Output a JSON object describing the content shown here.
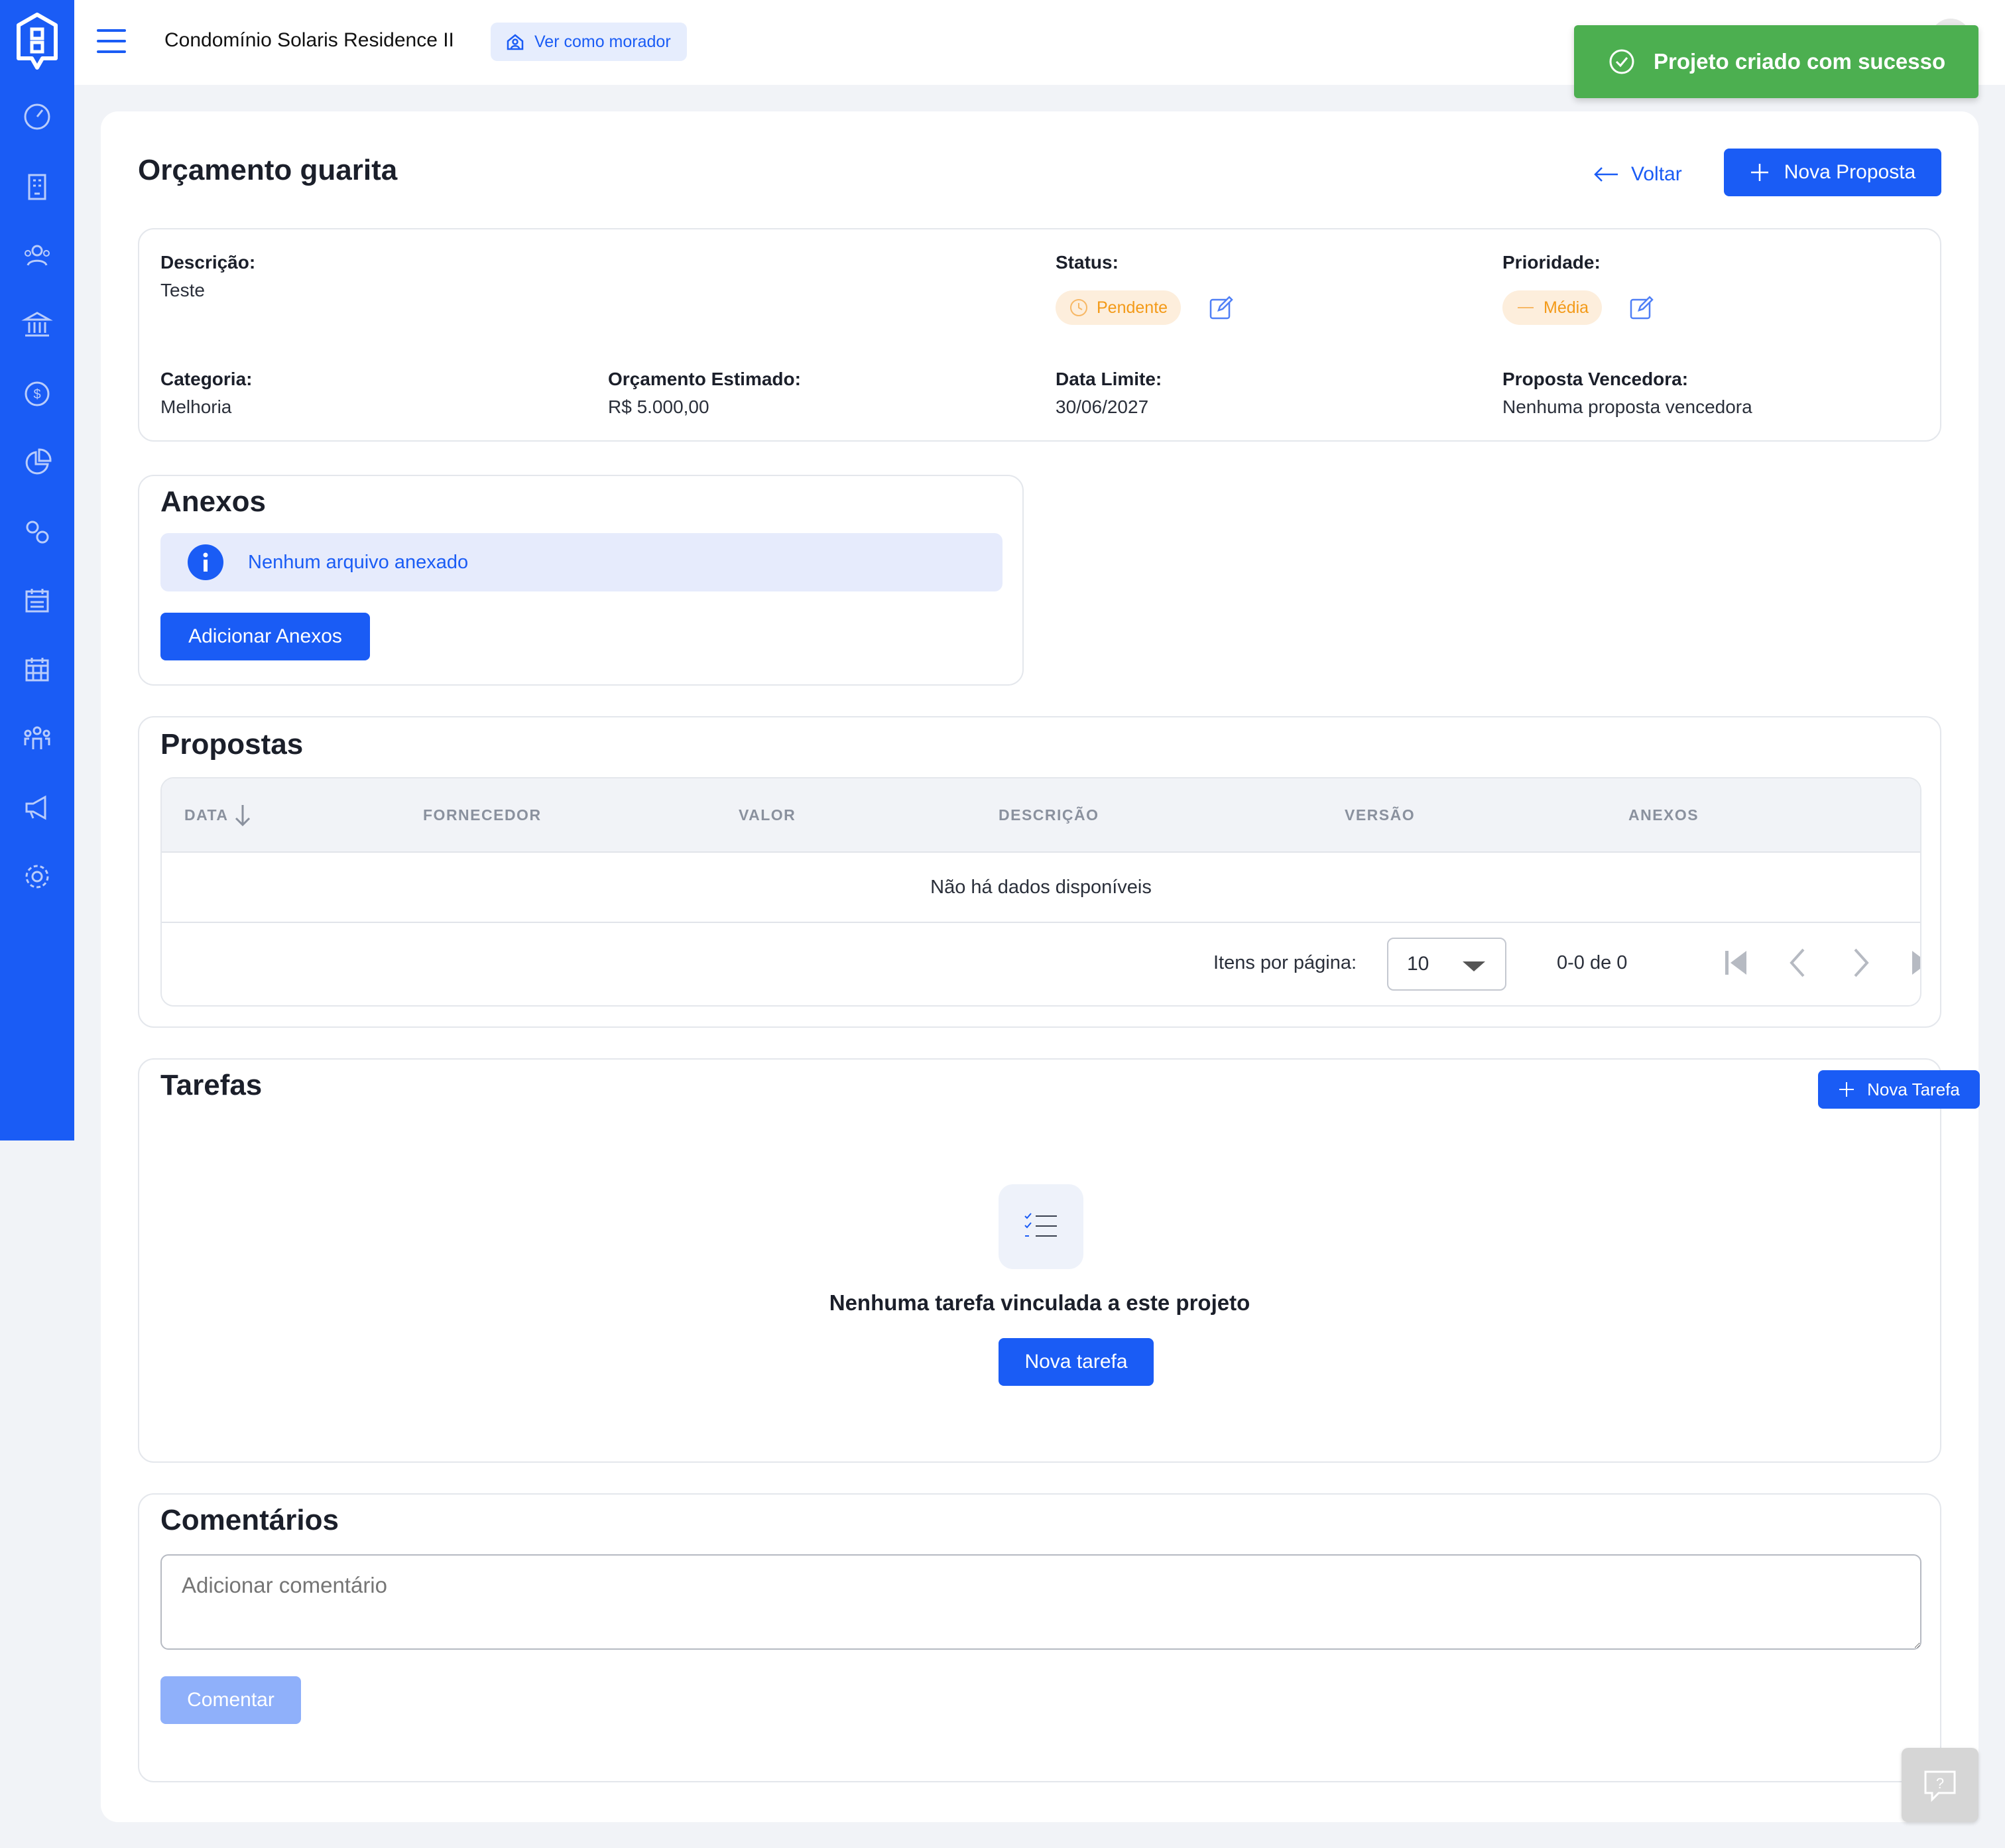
{
  "header": {
    "condo_name": "Condomínio Solaris Residence II",
    "view_as_label": "Ver como morador"
  },
  "toast": {
    "message": "Projeto criado com sucesso",
    "color": "#4caf50"
  },
  "page": {
    "title": "Orçamento guarita",
    "back_label": "Voltar",
    "new_proposal_label": "Nova Proposta"
  },
  "details": {
    "description_label": "Descrição:",
    "description_value": "Teste",
    "status_label": "Status:",
    "status_value": "Pendente",
    "priority_label": "Prioridade:",
    "priority_value": "Média",
    "category_label": "Categoria:",
    "category_value": "Melhoria",
    "budget_label": "Orçamento Estimado:",
    "budget_value": "R$ 5.000,00",
    "deadline_label": "Data Limite:",
    "deadline_value": "30/06/2027",
    "winner_label": "Proposta Vencedora:",
    "winner_value": "Nenhuma proposta vencedora"
  },
  "attachments": {
    "title": "Anexos",
    "empty_message": "Nenhum arquivo anexado",
    "add_button": "Adicionar Anexos"
  },
  "proposals": {
    "title": "Propostas",
    "columns": [
      "DATA",
      "FORNECEDOR",
      "VALOR",
      "DESCRIÇÃO",
      "VERSÃO",
      "ANEXOS"
    ],
    "empty_message": "Não há dados disponíveis",
    "items_per_page_label": "Itens por página:",
    "items_per_page_value": "10",
    "range_label": "0-0 de 0"
  },
  "tasks": {
    "title": "Tarefas",
    "new_task_top": "Nova Tarefa",
    "empty_message": "Nenhuma tarefa vinculada a este projeto",
    "new_task_button": "Nova tarefa"
  },
  "comments": {
    "title": "Comentários",
    "placeholder": "Adicionar comentário",
    "submit_button": "Comentar"
  },
  "colors": {
    "primary": "#1a5cf5",
    "status_pending": "#f39a18",
    "success": "#4caf50"
  },
  "sidebar_icons": [
    "dashboard-icon",
    "building-icon",
    "people-icon",
    "bank-icon",
    "money-icon",
    "pie-chart-icon",
    "gears-icon",
    "calendar-icon",
    "calendar-grid-icon",
    "community-icon",
    "megaphone-icon",
    "settings-icon"
  ]
}
